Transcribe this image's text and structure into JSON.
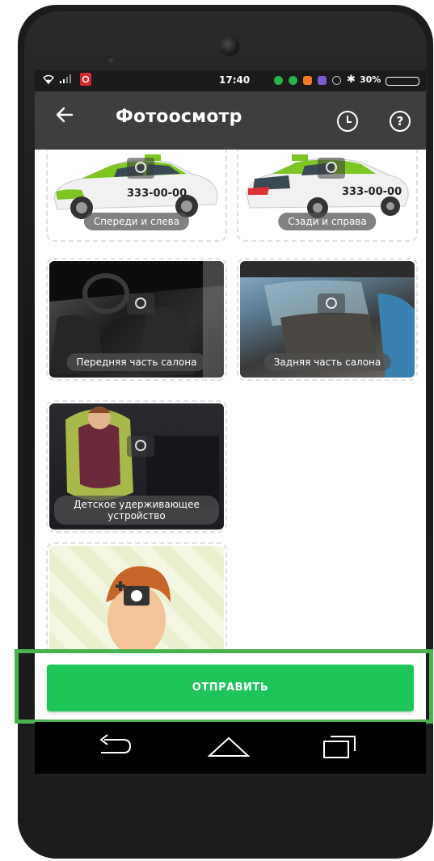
{
  "status": {
    "time": "17:40",
    "battery": "30%"
  },
  "appbar": {
    "title": "Фотоосмотр"
  },
  "tiles": [
    {
      "caption": "Спереди и слева",
      "plate": "333-00-00"
    },
    {
      "caption": "Сзади и справа",
      "plate": "333-00-00"
    },
    {
      "caption": "Передняя часть салона"
    },
    {
      "caption": "Задняя часть салона"
    },
    {
      "caption_line1": "Детское удерживающее",
      "caption_line2": "устройство"
    }
  ],
  "send": {
    "label": "ОТПРАВИТЬ"
  },
  "colors": {
    "accent": "#1ec659",
    "appbar": "#3e3e3e",
    "highlight": "#4bb14e",
    "taxi_green": "#7dc623"
  },
  "icons": [
    "back-arrow-icon",
    "history-icon",
    "help-icon",
    "camera-icon",
    "nav-back-icon",
    "nav-home-icon",
    "nav-recents-icon"
  ]
}
